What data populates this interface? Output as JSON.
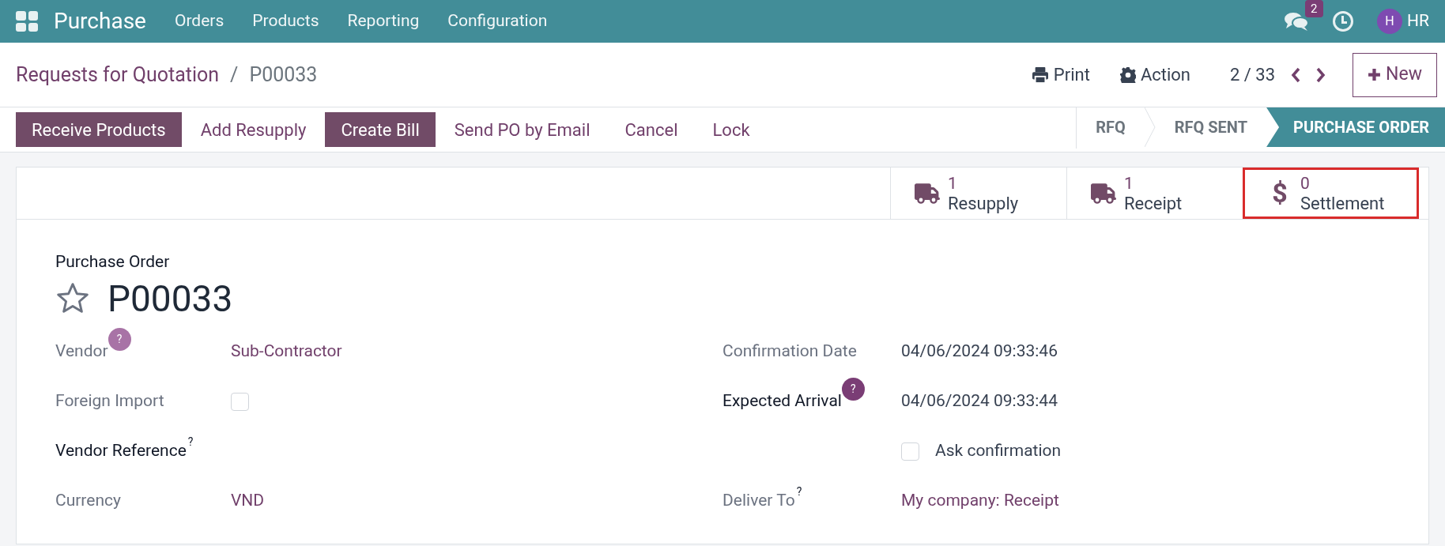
{
  "navbar": {
    "app_name": "Purchase",
    "menu": [
      "Orders",
      "Products",
      "Reporting",
      "Configuration"
    ],
    "messages_badge": "2",
    "user_initial": "H",
    "user_name": "HR"
  },
  "breadcrumb": {
    "parent": "Requests for Quotation",
    "separator": "/",
    "current": "P00033"
  },
  "toolbar": {
    "print": "Print",
    "action": "Action",
    "pager": "2 / 33",
    "new_button": "New"
  },
  "action_buttons": [
    {
      "label": "Receive Products",
      "kind": "primary"
    },
    {
      "label": "Add Resupply",
      "kind": "secondary"
    },
    {
      "label": "Create Bill",
      "kind": "primary"
    },
    {
      "label": "Send PO by Email",
      "kind": "secondary"
    },
    {
      "label": "Cancel",
      "kind": "secondary"
    },
    {
      "label": "Lock",
      "kind": "secondary"
    }
  ],
  "status_steps": [
    {
      "label": "RFQ",
      "selected": false
    },
    {
      "label": "RFQ SENT",
      "selected": false
    },
    {
      "label": "PURCHASE ORDER",
      "selected": true
    }
  ],
  "smart_buttons": [
    {
      "kind": "truck",
      "count": "1",
      "label": "Resupply",
      "highlighted": false
    },
    {
      "kind": "truck",
      "count": "1",
      "label": "Receipt",
      "highlighted": false
    },
    {
      "kind": "dollar",
      "icon_text": "$",
      "count": "0",
      "label": "Settlement",
      "highlighted": true
    }
  ],
  "form": {
    "subtitle": "Purchase Order",
    "title": "P00033",
    "starred": false,
    "left_fields": [
      {
        "kind": "link",
        "label": "Vendor",
        "required": false,
        "help": {
          "kind": "badge",
          "text": "?",
          "strong": false
        },
        "value": "Sub-Contractor"
      },
      {
        "kind": "checkbox",
        "label": "Foreign Import",
        "required": false,
        "checked": false
      },
      {
        "kind": "empty",
        "label": "Vendor Reference",
        "required": true,
        "help": {
          "kind": "sup",
          "text": "?"
        }
      },
      {
        "kind": "link",
        "label": "Currency",
        "required": false,
        "value": "VND"
      }
    ],
    "right_fields": [
      {
        "kind": "text",
        "label": "Confirmation Date",
        "required": false,
        "value": "04/06/2024 09:33:46"
      },
      {
        "kind": "text",
        "label": "Expected Arrival",
        "required": true,
        "help": {
          "kind": "badge",
          "text": "?",
          "strong": true
        },
        "value": "04/06/2024 09:33:44"
      },
      {
        "kind": "checkbox",
        "checked": false,
        "checkbox_label": "Ask confirmation"
      },
      {
        "kind": "link",
        "label": "Deliver To",
        "required": false,
        "help": {
          "kind": "sup",
          "text": "?"
        },
        "value": "My company: Receipt"
      }
    ]
  }
}
